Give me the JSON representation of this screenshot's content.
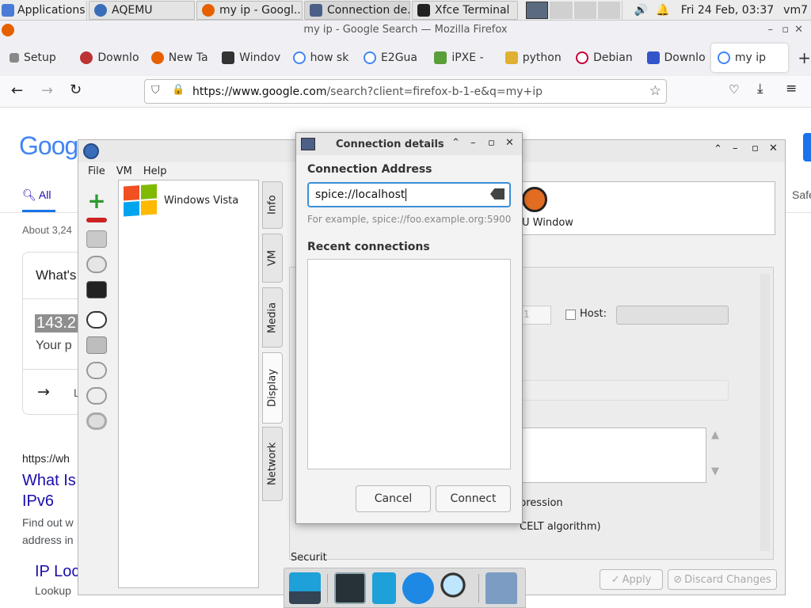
{
  "panel": {
    "applications": "Applications",
    "tasks": [
      "AQEMU",
      "my ip - Googl...",
      "Connection de...",
      "Xfce Terminal"
    ],
    "clock": "Fri 24 Feb, 03:37",
    "user": "vm7"
  },
  "firefox": {
    "window_title": "my ip - Google Search — Mozilla Firefox",
    "tabs": [
      "Setup",
      "Downlo",
      "New Ta",
      "Windov",
      "how sk",
      "E2Gua",
      "iPXE -",
      "python",
      "Debian",
      "Downlo",
      "my ip"
    ],
    "url_host": "https://www.google.com",
    "url_rest": "/search?client=firefox-b-1-e&q=my+ip"
  },
  "google": {
    "logo": "Goog",
    "tab_all": "All",
    "safe": "Safe",
    "about": "About 3,24",
    "whats": "What's",
    "ip": "143.2",
    "your": "Your p",
    "arrow_text": "L",
    "result_url": "https://wh",
    "result_title_1": "What Is",
    "result_title_2": "IPv6",
    "result_desc_1": "Find out w",
    "result_desc_2": "address in",
    "result2_title": "IP Loc",
    "result2_desc": "Lookup"
  },
  "aqemu": {
    "menu": [
      "File",
      "VM",
      "Help"
    ],
    "vm_name": "Windows Vista",
    "side_tabs": [
      "Info",
      "VM",
      "Media",
      "Display",
      "Network"
    ],
    "window_label": "U Window",
    "host_label": "Host:",
    "spin_value": "1",
    "compression_text": "pression",
    "celt_text": "CELT algorithm)",
    "security_text": "Securit",
    "apply": "Apply",
    "discard": "Discard Changes"
  },
  "dialog": {
    "title": "Connection details",
    "address_label": "Connection Address",
    "address_value": "spice://localhost",
    "example": "For example, spice://foo.example.org:5900",
    "recent_label": "Recent connections",
    "cancel": "Cancel",
    "connect": "Connect"
  }
}
